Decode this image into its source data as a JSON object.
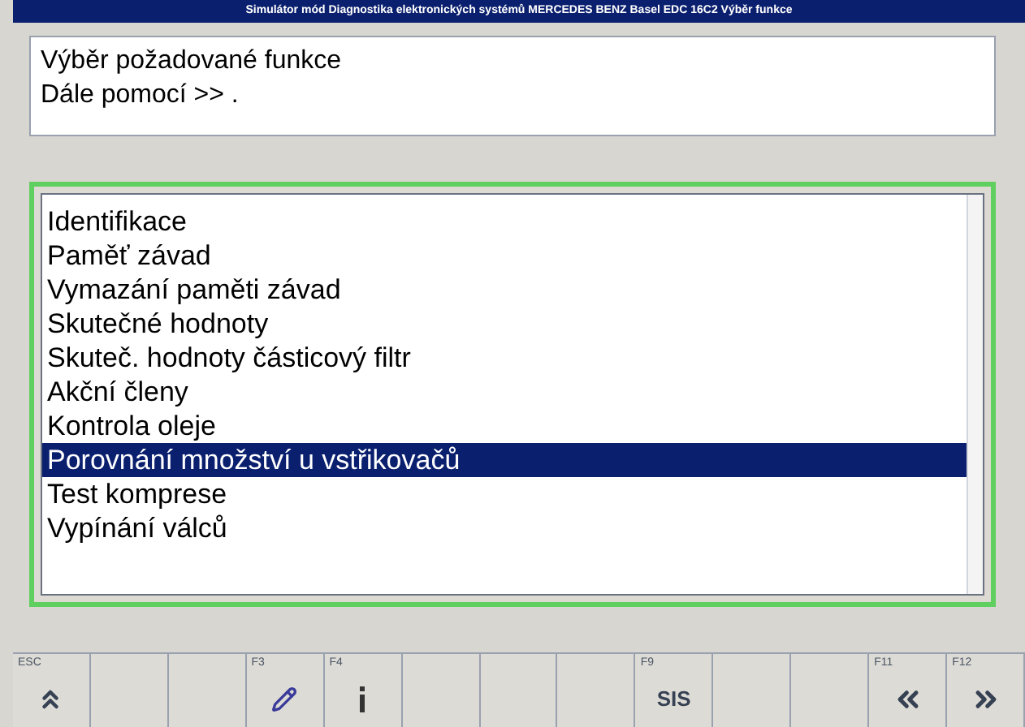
{
  "window": {
    "title": "Simulátor mód Diagnostika elektronických systémů MERCEDES BENZ Basel EDC 16C2 Výběr funkce"
  },
  "message": [
    "Výběr požadované funkce",
    "Dále pomocí >> ."
  ],
  "functions": [
    {
      "label": "Identifikace",
      "selected": false
    },
    {
      "label": "Paměť závad",
      "selected": false
    },
    {
      "label": "Vymazání paměti závad",
      "selected": false
    },
    {
      "label": "Skutečné hodnoty",
      "selected": false
    },
    {
      "label": "Skuteč. hodnoty částicový filtr",
      "selected": false
    },
    {
      "label": "Akční členy",
      "selected": false
    },
    {
      "label": "Kontrola oleje",
      "selected": false
    },
    {
      "label": "Porovnání množství u vstřikovačů",
      "selected": true
    },
    {
      "label": "Test komprese",
      "selected": false
    },
    {
      "label": "Vypínání válců",
      "selected": false
    }
  ],
  "function_keys": [
    {
      "key": "ESC",
      "kind": "up"
    },
    {
      "kind": "empty"
    },
    {
      "kind": "empty"
    },
    {
      "key": "F3",
      "kind": "pencil"
    },
    {
      "key": "F4",
      "kind": "info"
    },
    {
      "kind": "empty"
    },
    {
      "kind": "empty"
    },
    {
      "kind": "empty"
    },
    {
      "key": "F9",
      "kind": "text",
      "text": "SIS"
    },
    {
      "kind": "empty"
    },
    {
      "kind": "empty"
    },
    {
      "key": "F11",
      "kind": "back"
    },
    {
      "key": "F12",
      "kind": "forward"
    }
  ]
}
